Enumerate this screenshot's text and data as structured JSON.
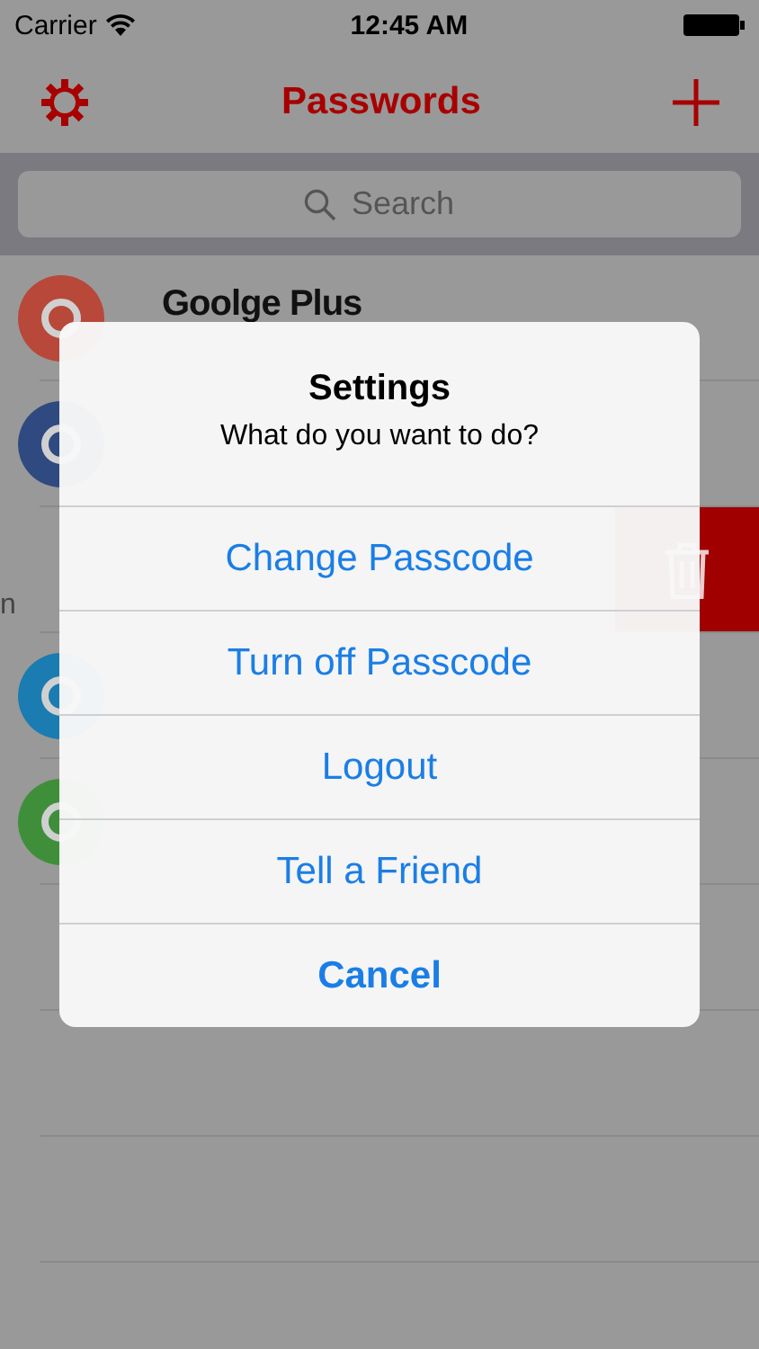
{
  "status_bar": {
    "carrier": "Carrier",
    "time": "12:45 AM"
  },
  "nav_bar": {
    "title": "Passwords"
  },
  "search": {
    "placeholder": "Search"
  },
  "rows": [
    {
      "name": "Goolge Plus",
      "swiped": false,
      "color": "#b8483a"
    },
    {
      "swiped": false,
      "color": "#2f4a80"
    },
    {
      "name": "n",
      "swiped": true
    },
    {
      "swiped": false,
      "color": "#1a7cb0"
    },
    {
      "swiped": false,
      "color": "#3f8f3a"
    }
  ],
  "dialog": {
    "title": "Settings",
    "message": "What do you want to do?",
    "actions": [
      {
        "label": "Change Passcode",
        "kind": "default"
      },
      {
        "label": "Turn off Passcode",
        "kind": "default"
      },
      {
        "label": "Logout",
        "kind": "default"
      },
      {
        "label": "Tell a Friend",
        "kind": "default"
      },
      {
        "label": "Cancel",
        "kind": "cancel"
      }
    ]
  }
}
